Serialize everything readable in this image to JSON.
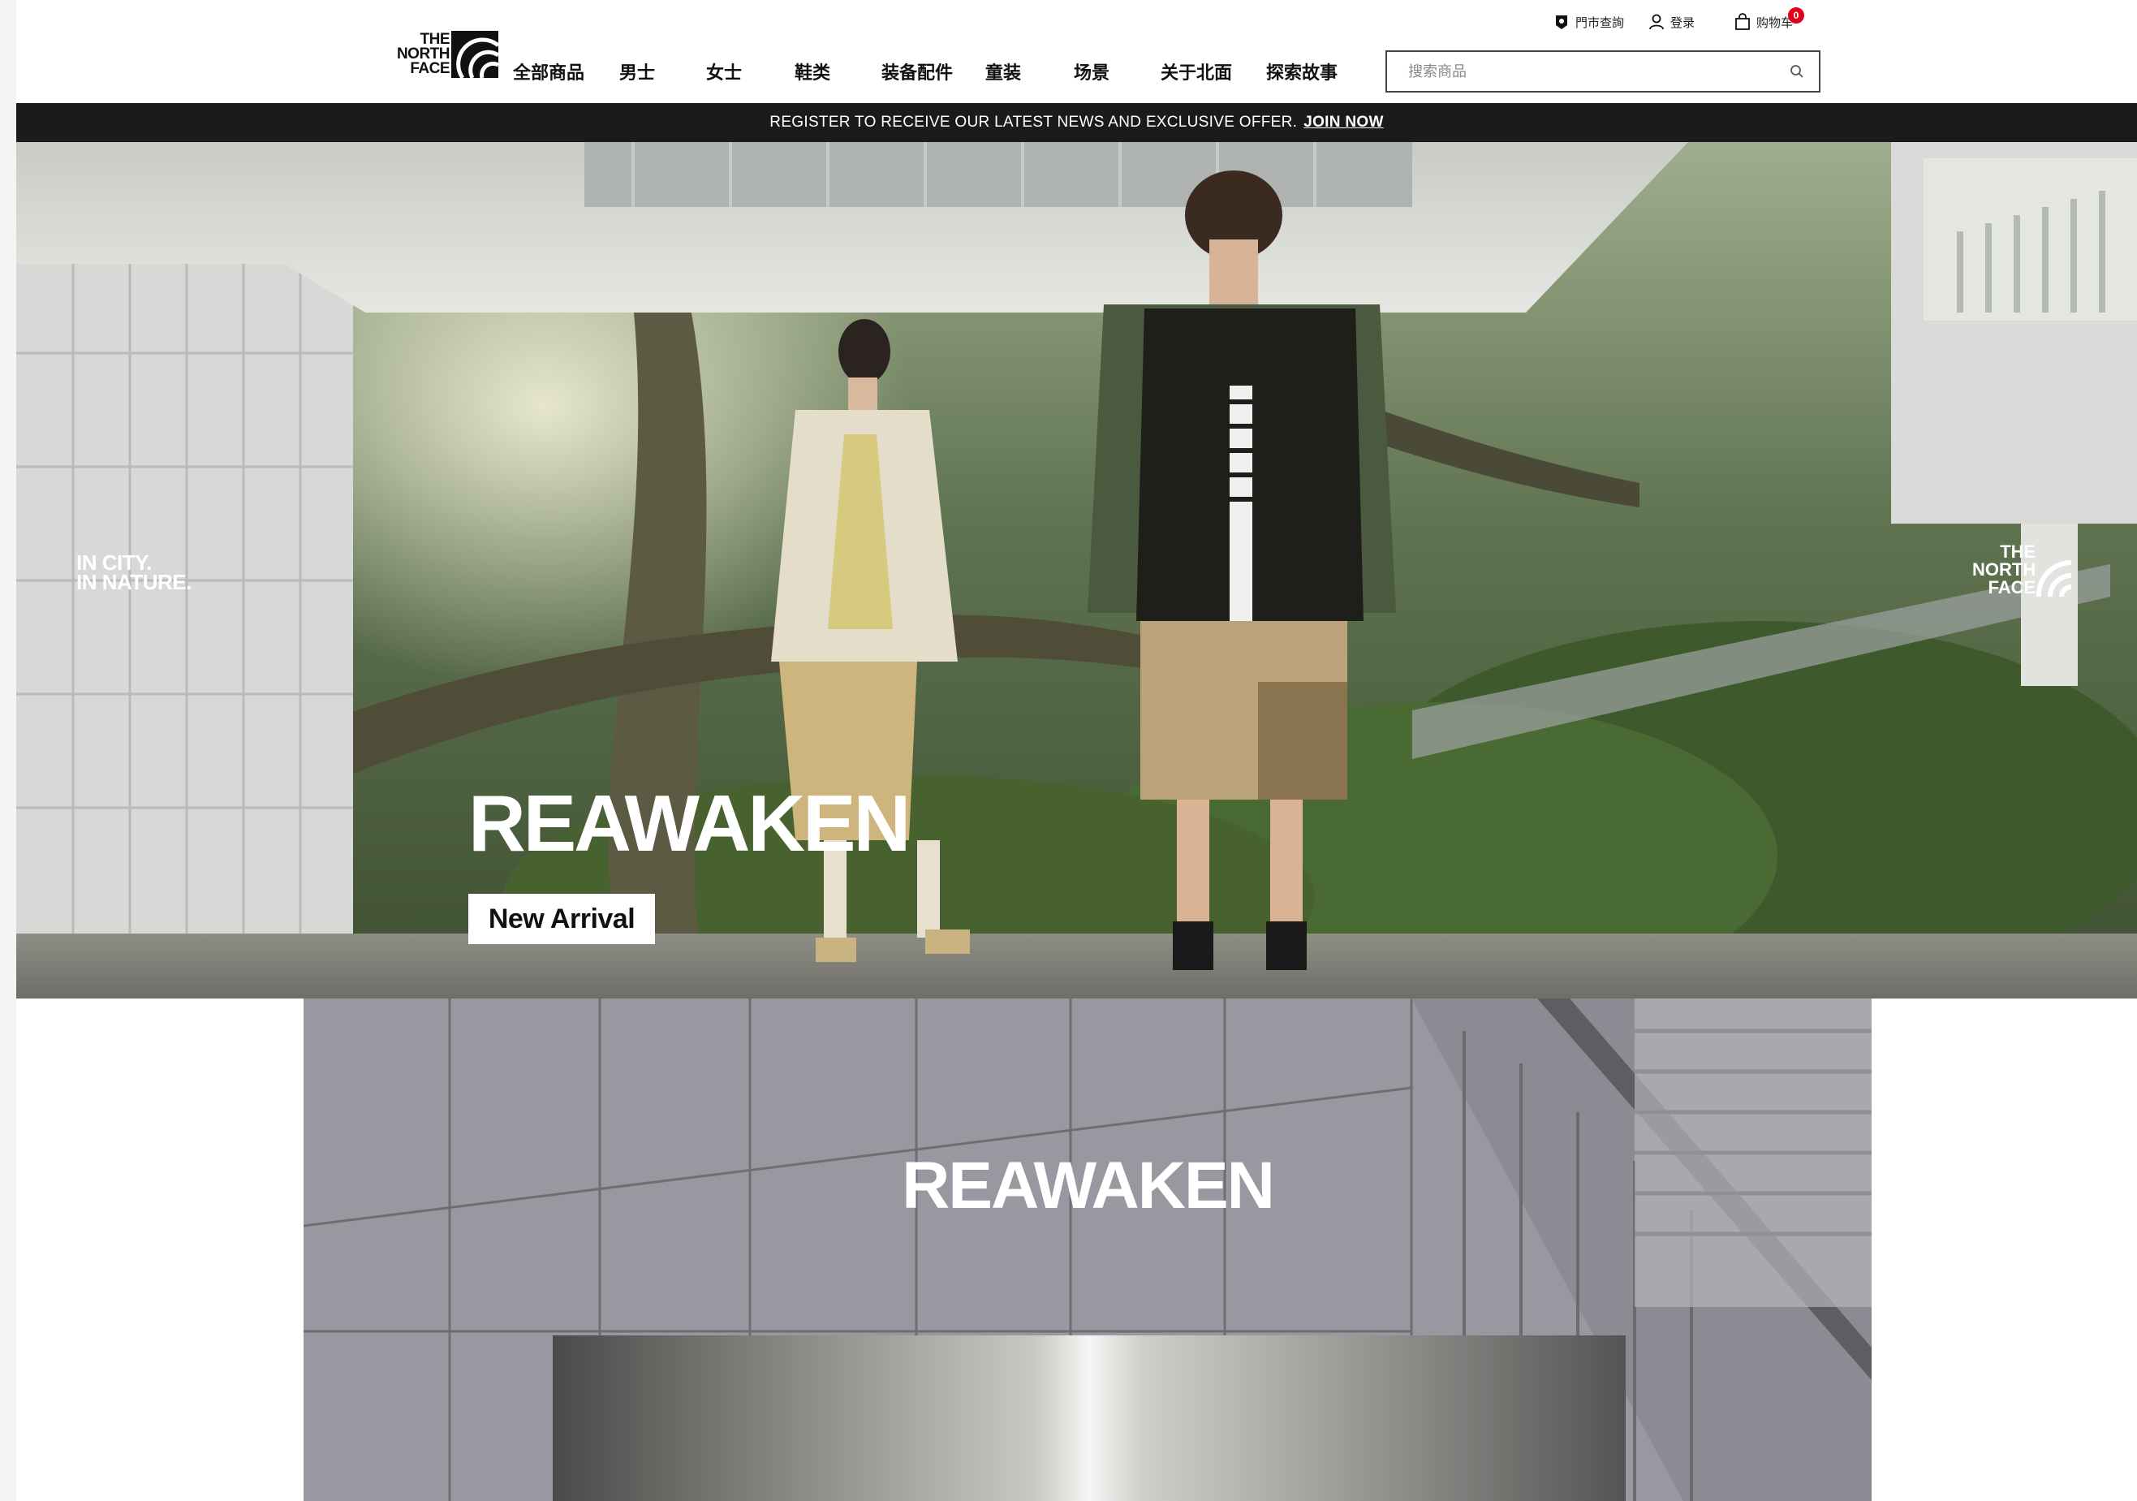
{
  "header": {
    "logo_lines": [
      "THE",
      "NORTH",
      "FACE"
    ],
    "utility": {
      "store_label": "門市查詢",
      "login_label": "登录",
      "cart_label": "购物车",
      "cart_count": "0"
    },
    "nav": [
      "全部商品",
      "男士",
      "女士",
      "鞋类",
      "装备配件",
      "童装",
      "场景",
      "关于北面",
      "探索故事"
    ],
    "search": {
      "placeholder": "搜索商品"
    }
  },
  "promo": {
    "text": "REGISTER TO RECEIVE OUR LATEST NEWS AND EXCLUSIVE OFFER.",
    "link": "JOIN NOW"
  },
  "hero": {
    "tagline": [
      "IN CITY.",
      "IN NATURE."
    ],
    "side_logo": [
      "THE",
      "NORTH",
      "FACE"
    ],
    "title": "REAWAKEN",
    "button": "New Arrival"
  },
  "section2": {
    "title": "REAWAKEN"
  },
  "colors": {
    "promo_bar": "#1b1b1b",
    "cart_badge": "#e3001b",
    "section_bg": "#9a97a0"
  }
}
